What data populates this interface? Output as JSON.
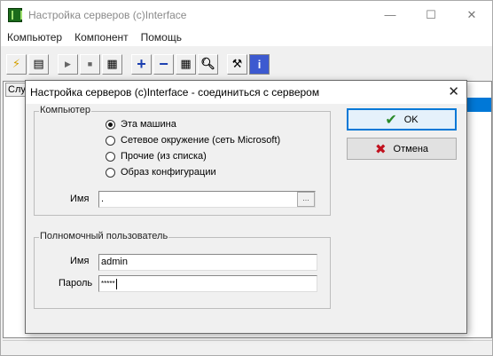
{
  "window": {
    "title": "Настройка серверов (c)Interface"
  },
  "menu": [
    "Компьютер",
    "Компонент",
    "Помощь"
  ],
  "toolbar": {
    "icons": [
      "lightning-icon",
      "print-preview-icon",
      "play-icon",
      "stop-icon",
      "grid-icon",
      "add-icon",
      "remove-icon",
      "properties-icon",
      "find-icon",
      "tools-icon",
      "info-icon"
    ]
  },
  "list": {
    "header": "Слу"
  },
  "dialog": {
    "title": "Настройка серверов (c)Interface - соединиться с сервером",
    "computer_group": "Компьютер",
    "radio_options": [
      "Эта машина",
      "Сетевое окружение (сеть Microsoft)",
      "Прочие  (из списка)",
      "Образ конфигурации"
    ],
    "selected_option": "Эта машина",
    "name_label": "Имя",
    "name_value": ".",
    "browse_label": "...",
    "user_group": "Полномочный пользователь",
    "user_name_label": "Имя",
    "user_name_value": "admin",
    "password_label": "Пароль",
    "password_value": "*****",
    "ok_label": "OK",
    "cancel_label": "Отмена"
  }
}
